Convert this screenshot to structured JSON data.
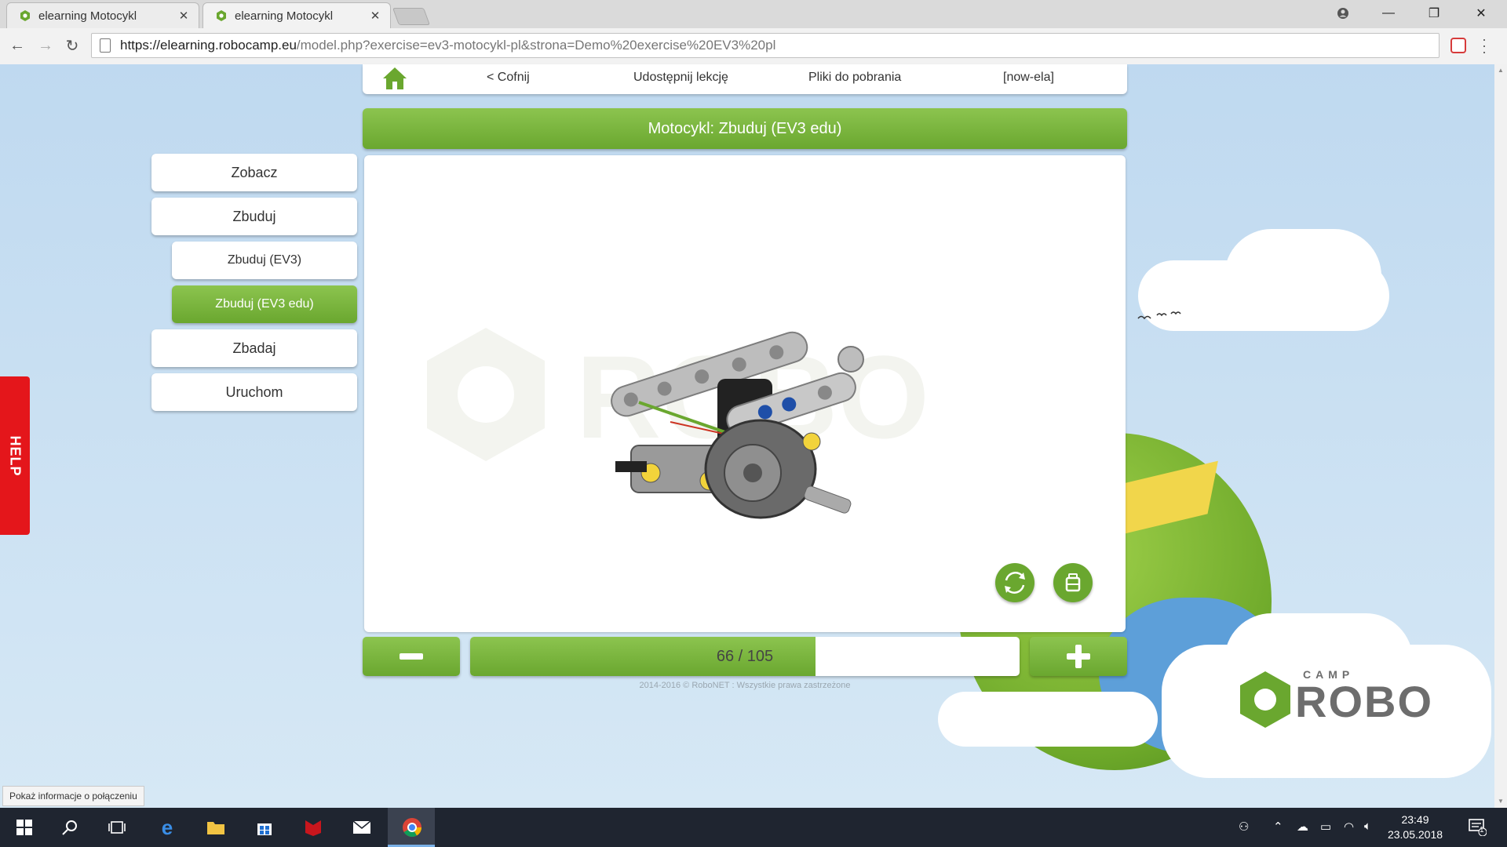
{
  "browser": {
    "tabs": [
      {
        "title": "elearning Motocykl",
        "active": false
      },
      {
        "title": "elearning Motocykl",
        "active": true
      }
    ],
    "url_host": "https://elearning.robocamp.eu",
    "url_path": "/model.php?exercise=ev3-motocykl-pl&strona=Demo%20exercise%20EV3%20pl",
    "status_bubble": "Pokaż informacje o połączeniu"
  },
  "nav": {
    "back": "< Cofnij",
    "share": "Udostępnij lekcję",
    "downloads": "Pliki do pobrania",
    "user": "[now-ela]"
  },
  "page_title": "Motocykl: Zbuduj (EV3 edu)",
  "sidebar": {
    "items": [
      {
        "label": "Zobacz",
        "level": "main",
        "active": false
      },
      {
        "label": "Zbuduj",
        "level": "main",
        "active": false
      },
      {
        "label": "Zbuduj (EV3)",
        "level": "sub",
        "active": false
      },
      {
        "label": "Zbuduj (EV3 edu)",
        "level": "sub",
        "active": true
      },
      {
        "label": "Zbadaj",
        "level": "main",
        "active": false
      },
      {
        "label": "Uruchom",
        "level": "main",
        "active": false
      }
    ]
  },
  "stepper": {
    "label": "66 / 105",
    "current": 66,
    "total": 105
  },
  "copyright": "2014-2016 © RoboNET : Wszystkie prawa zastrzeżone",
  "help_label": "HELP",
  "logo": {
    "camp": "CAMP",
    "robo": "ROBO"
  },
  "taskbar": {
    "time": "23:49",
    "date": "23.05.2018",
    "notifications": "1"
  },
  "colors": {
    "green": "#6aa72f",
    "green_light": "#8cc44f",
    "help_red": "#e4161b"
  }
}
